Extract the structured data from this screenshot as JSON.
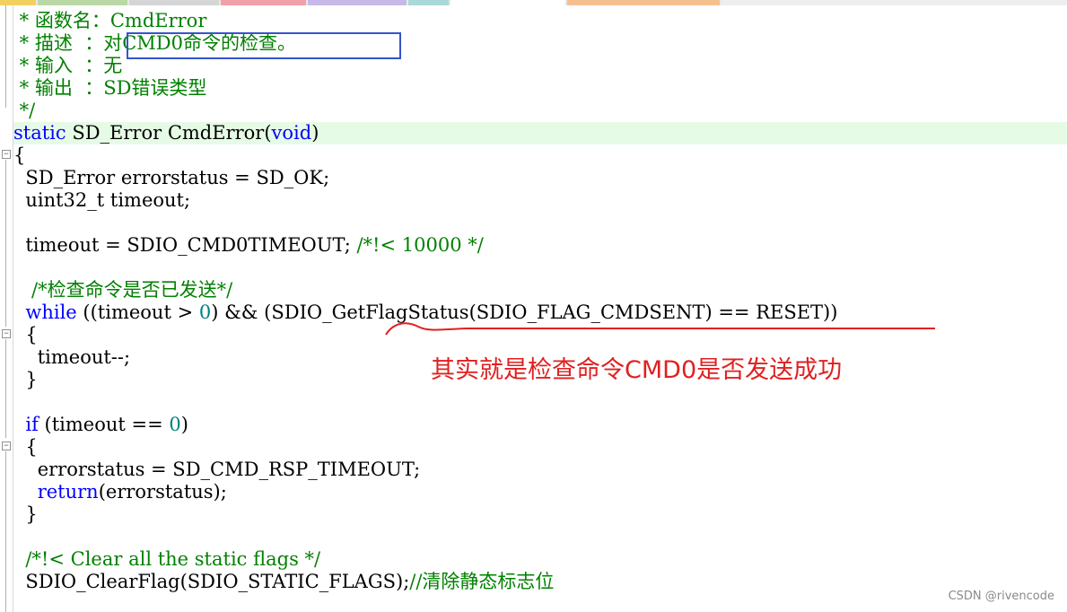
{
  "colors": {
    "comment": "#008000",
    "keyword": "#0000ff",
    "number": "#008080",
    "current_line": "#e6fbe6",
    "annotation": "#e02020",
    "highlight_box": "#3355cc"
  },
  "icons": {
    "fold": "minus-box-icon"
  },
  "code": {
    "l1": " * 函数名：CmdError",
    "l2": " * 描述  ：对CMD0命令的检查。",
    "l3": " * 输入  ：无",
    "l4": " * 输出  ：SD错误类型",
    "l5": " */",
    "l6_kw1": "static",
    "l6_rest": " SD_Error CmdError(",
    "l6_kw2": "void",
    "l6_end": ")",
    "l7": "{",
    "l8": "  SD_Error errorstatus = SD_OK;",
    "l9": "  uint32_t timeout;",
    "l11_code": "  timeout = SDIO_CMD0TIMEOUT; ",
    "l11_comment": "/*!< 10000 */",
    "l13": "   /*检查命令是否已发送*/",
    "l14_kw": "while",
    "l14_a": " ((timeout > ",
    "l14_num": "0",
    "l14_b": ") && (SDIO_GetFlagStatus(SDIO_FLAG_CMDSENT) == RESET))",
    "l15": "  {",
    "l16": "    timeout--;",
    "l17": "  }",
    "l19_kw": "if",
    "l19_a": " (timeout == ",
    "l19_num": "0",
    "l19_b": ")",
    "l20": "  {",
    "l21": "    errorstatus = SD_CMD_RSP_TIMEOUT;",
    "l22_kw": "return",
    "l22_rest": "(errorstatus);",
    "l23": "  }",
    "l25": "  /*!< Clear all the static flags */",
    "l26_code": "  SDIO_ClearFlag(SDIO_STATIC_FLAGS);",
    "l26_comment": "//清除静态标志位"
  },
  "annotation": {
    "text": "其实就是检查命令CMD0是否发送成功"
  },
  "watermark": "CSDN @rivencode"
}
